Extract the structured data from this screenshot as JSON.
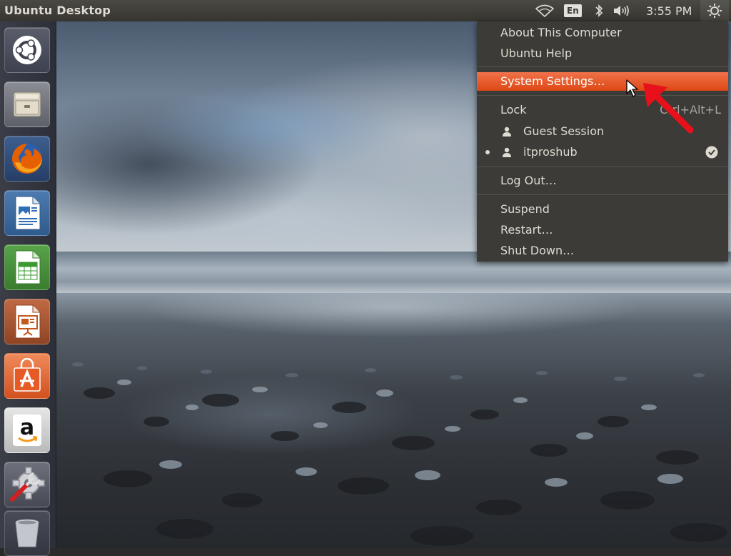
{
  "panel": {
    "title": "Ubuntu Desktop",
    "keyboard_layout": "En",
    "clock": "3:55 PM",
    "icons": [
      "wifi-icon",
      "bluetooth-icon",
      "sound-icon",
      "gear-icon"
    ]
  },
  "launcher": {
    "items": [
      {
        "name": "dash-home",
        "icon": "ubuntu-logo-icon"
      },
      {
        "name": "files",
        "icon": "file-cabinet-icon"
      },
      {
        "name": "firefox",
        "icon": "firefox-icon"
      },
      {
        "name": "libreoffice-writer",
        "icon": "writer-doc-icon"
      },
      {
        "name": "libreoffice-calc",
        "icon": "calc-sheet-icon"
      },
      {
        "name": "libreoffice-impress",
        "icon": "impress-slide-icon"
      },
      {
        "name": "ubuntu-software-center",
        "icon": "shopping-bag-icon"
      },
      {
        "name": "amazon",
        "icon": "amazon-icon"
      },
      {
        "name": "system-settings",
        "icon": "settings-tools-icon"
      },
      {
        "name": "trash",
        "icon": "trash-icon"
      }
    ]
  },
  "system_menu": {
    "about": "About This Computer",
    "help": "Ubuntu Help",
    "settings": "System Settings…",
    "lock": "Lock",
    "lock_shortcut": "Ctrl+Alt+L",
    "guest": "Guest Session",
    "user": "itproshub",
    "logout": "Log Out…",
    "suspend": "Suspend",
    "restart": "Restart…",
    "shutdown": "Shut Down…"
  },
  "colors": {
    "highlight": "#dd4814",
    "menu_bg": "#3c3b37",
    "annotation": "#e8101a"
  }
}
